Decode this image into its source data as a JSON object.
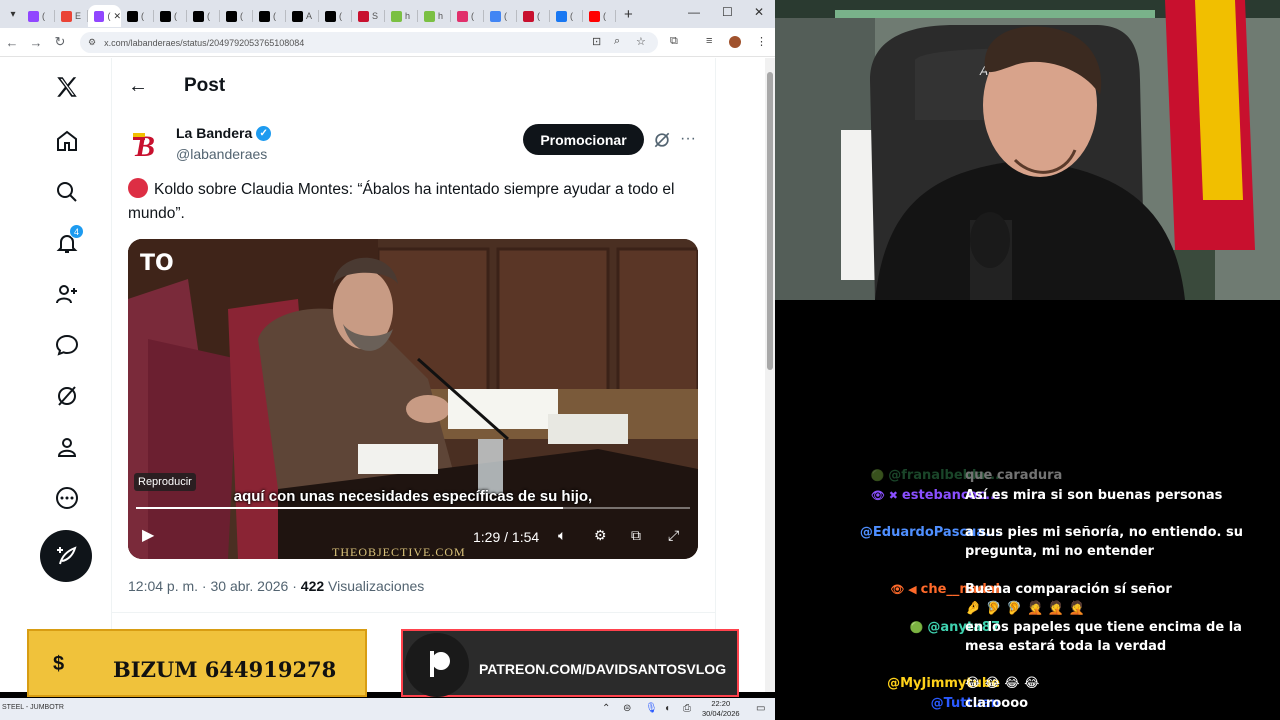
{
  "browser": {
    "tabs": [
      {
        "icon": "twitch-icon",
        "title": "(",
        "color": "#9146ff"
      },
      {
        "icon": "gmail-icon",
        "title": "E",
        "color": "#ea4335"
      },
      {
        "icon": "twitch-icon",
        "title": "(",
        "color": "#9146ff",
        "active": true
      },
      {
        "icon": "x-icon",
        "title": "(",
        "color": "#000000"
      },
      {
        "icon": "x-icon",
        "title": "(",
        "color": "#000000"
      },
      {
        "icon": "x-icon",
        "title": "(",
        "color": "#000000"
      },
      {
        "icon": "x-icon",
        "title": "(",
        "color": "#000000"
      },
      {
        "icon": "x-icon",
        "title": "(",
        "color": "#000000"
      },
      {
        "icon": "x-icon",
        "title": "A",
        "color": "#000000"
      },
      {
        "icon": "x-icon",
        "title": "(",
        "color": "#000000"
      },
      {
        "icon": "labandera-icon",
        "title": "S",
        "color": "#c8102e"
      },
      {
        "icon": "emoji-icon",
        "title": "h",
        "color": "#7bc043"
      },
      {
        "icon": "emoji-icon",
        "title": "h",
        "color": "#7bc043"
      },
      {
        "icon": "instagram-icon",
        "title": "(",
        "color": "#e1306c"
      },
      {
        "icon": "google-icon",
        "title": "(",
        "color": "#4285f4"
      },
      {
        "icon": "labandera-icon",
        "title": "(",
        "color": "#c8102e"
      },
      {
        "icon": "facebook-icon",
        "title": "(",
        "color": "#1877f2"
      },
      {
        "icon": "youtube-icon",
        "title": "(",
        "color": "#ff0000"
      }
    ],
    "url": "x.com/labanderaes/status/2049792053765108084"
  },
  "x": {
    "page_title": "Post",
    "notification_count": "4",
    "author_name": "La Bandera",
    "author_handle": "@labanderaes",
    "promote_label": "Promocionar",
    "tweet_text": "Koldo sobre Claudia Montes: “Ábalos ha intentado siempre ayudar a todo el mundo”.",
    "video": {
      "logo": "TO",
      "play_tooltip": "Reproducir",
      "subtitle": "aquí con unas necesidades específicas de su hijo,",
      "time": "1:29 / 1:54",
      "progress": 0.77,
      "watermark": "THEOBJECTIVE.COM"
    },
    "timestamp": "12:04 p. m. · 30 abr. 2026 · ",
    "views_count": "422",
    "views_label": " Visualizaciones"
  },
  "overlays": {
    "bizum_symbol": "$",
    "bizum_text": "BIZUM 644919278",
    "patreon_text": "PATREON.COM/DAVIDSANTOSVLOG"
  },
  "taskbar": {
    "left_text": "STEEL - JUMBOTR",
    "time": "22:20",
    "date": "30/04/2026"
  },
  "chat": {
    "messages": [
      {
        "user": "@franalbelda...",
        "color": "#3a9a5c",
        "text": "que caradura",
        "faded": true,
        "badges": "🟢"
      },
      {
        "user": "estebancoc...",
        "color": "#8a4fff",
        "text": "Así es mira si son buenas personas",
        "badges": "👁 ✖"
      },
      {
        "user": "@EduardoPascua...",
        "color": "#4f8fff",
        "text": "a sus pies mi señoría, no entiendo. su pregunta, mi no entender",
        "badges": ""
      },
      {
        "user": "che__nadal",
        "color": "#ff6a2a",
        "text": "Buena comparación sí señor",
        "badges": "👁 ◀",
        "emotes": "🤌 🦻 🦻 🤦 🤦 🤦"
      },
      {
        "user": "@anyta87",
        "color": "#3fd3b0",
        "text": "en los papeles que tiene encima de la mesa estará toda la verdad",
        "badges": "🟢"
      },
      {
        "user": "@MyJimmytube",
        "color": "#ffd21a",
        "text": "😂 😂 😂 😂",
        "badges": ""
      },
      {
        "user": "@Tuttuan",
        "color": "#2a5aff",
        "text": "claroooo",
        "badges": ""
      }
    ]
  }
}
